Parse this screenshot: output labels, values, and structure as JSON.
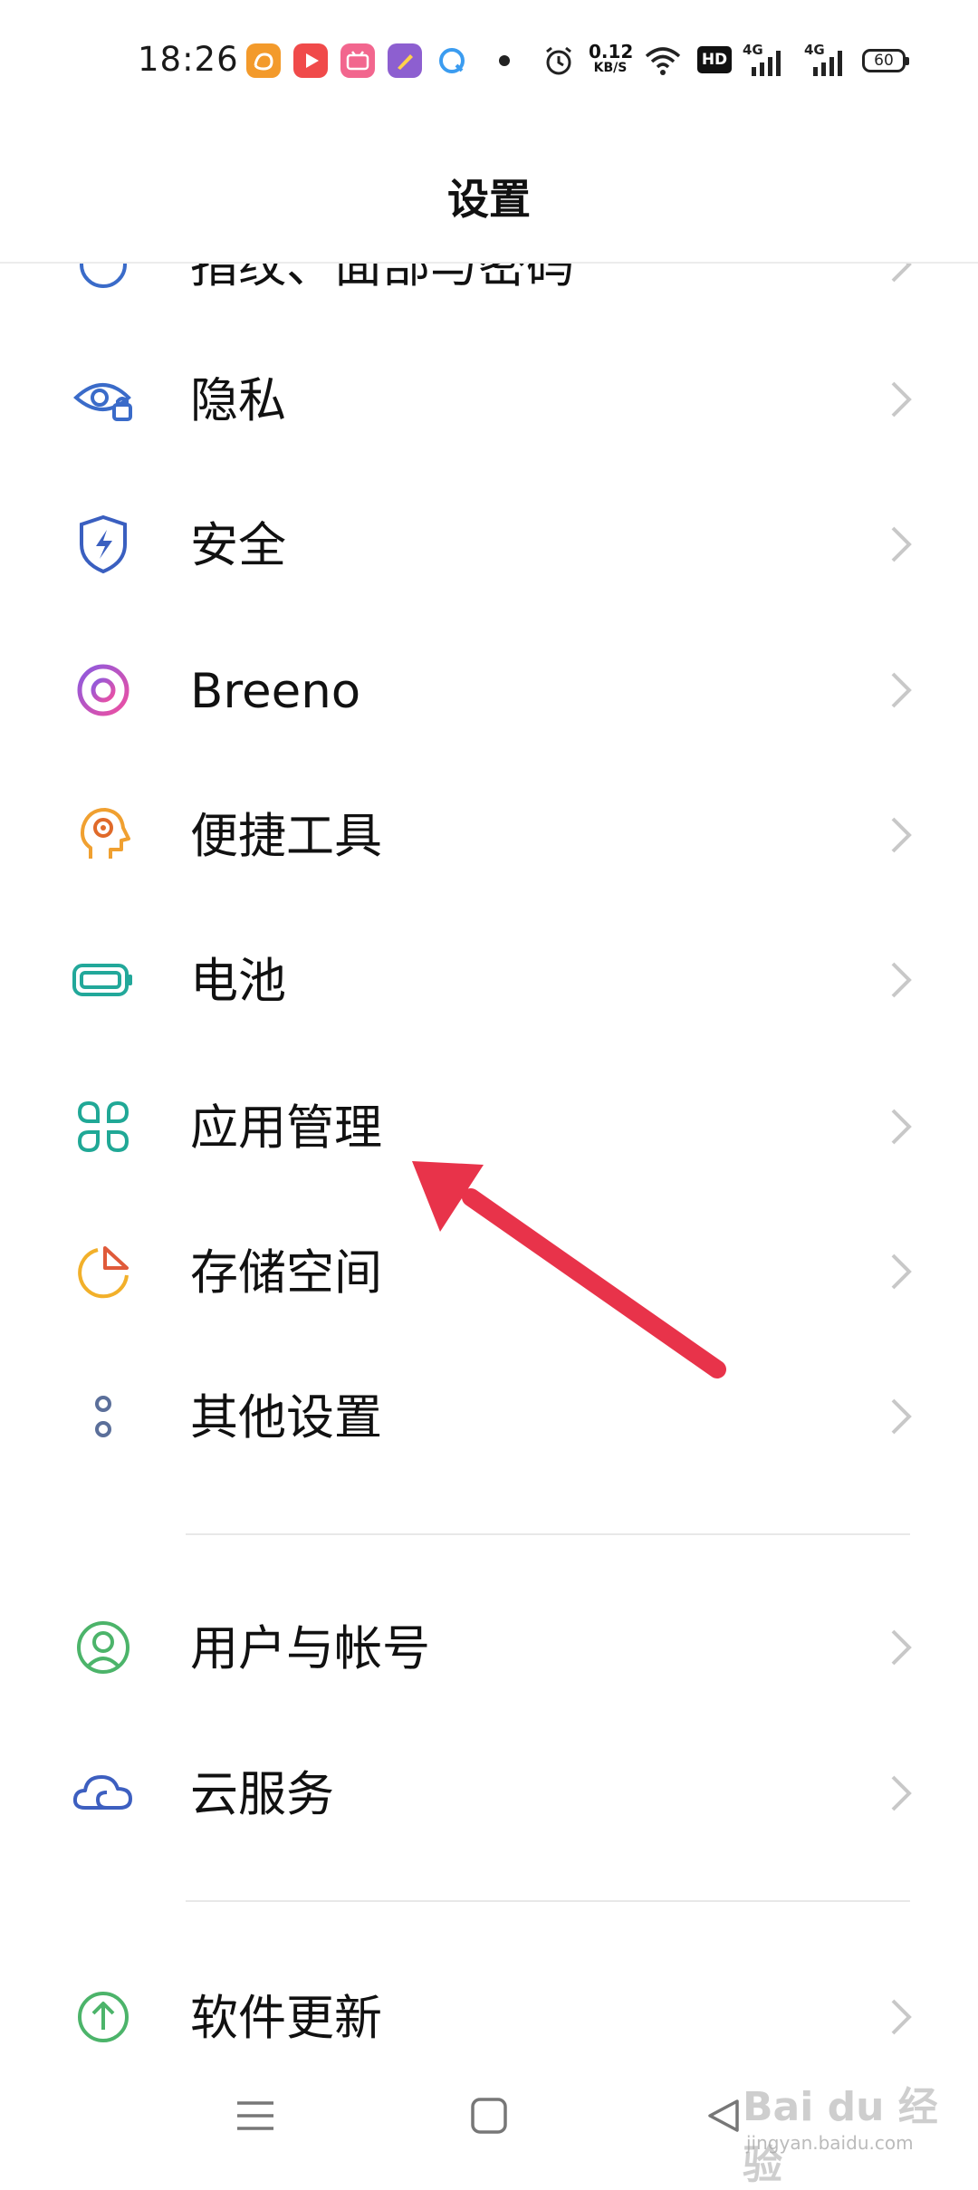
{
  "status_bar": {
    "time": "18:26",
    "net_speed_value": "0.12",
    "net_speed_unit": "KB/S",
    "hd_label": "HD",
    "signal1_label": "4G",
    "signal2_label": "4G",
    "battery": "60"
  },
  "header": {
    "title": "设置"
  },
  "settings": {
    "partial_item": "指纹、面部与密码",
    "items": [
      {
        "label": "隐私",
        "icon": "privacy-eye-lock-icon",
        "color": "#3a6bc9"
      },
      {
        "label": "安全",
        "icon": "security-shield-icon",
        "color": "#3a5fc0"
      },
      {
        "label": "Breeno",
        "icon": "breeno-ring-icon",
        "color": "#c153d8"
      },
      {
        "label": "便捷工具",
        "icon": "convenience-tools-icon",
        "color": "#f0a030"
      },
      {
        "label": "电池",
        "icon": "battery-icon",
        "color": "#22a89a"
      },
      {
        "label": "应用管理",
        "icon": "app-management-icon",
        "color": "#20a896"
      },
      {
        "label": "存储空间",
        "icon": "storage-pie-icon",
        "color": "#f2b02a"
      },
      {
        "label": "其他设置",
        "icon": "other-settings-icon",
        "color": "#5b6f9a"
      },
      {
        "label": "用户与帐号",
        "icon": "user-account-icon",
        "color": "#4cb46a"
      },
      {
        "label": "云服务",
        "icon": "cloud-service-icon",
        "color": "#3d5fc0"
      },
      {
        "label": "软件更新",
        "icon": "software-update-icon",
        "color": "#4cb46a"
      }
    ]
  },
  "watermark": {
    "brand": "Bai du 经验",
    "url": "jingyan.baidu.com"
  }
}
